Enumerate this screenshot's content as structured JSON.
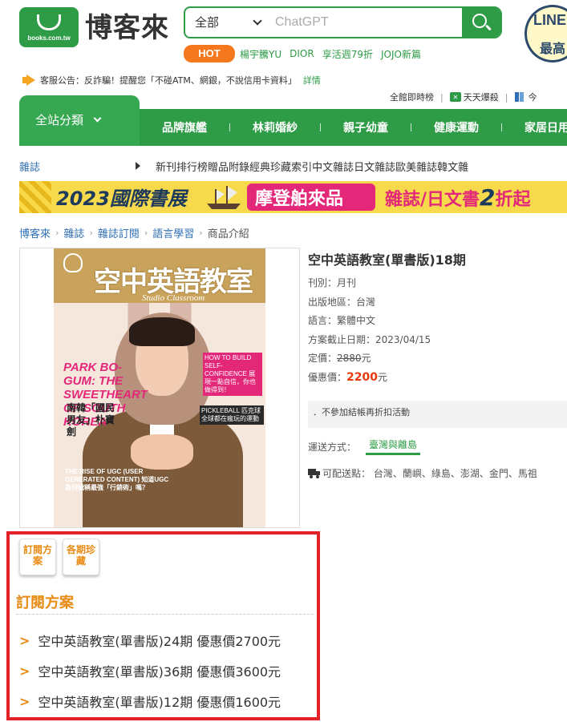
{
  "logo": {
    "text": "博客來",
    "sub": "books.com.tw"
  },
  "search": {
    "category": "全部",
    "placeholder": "ChatGPT"
  },
  "line_badge": {
    "top": "LINE",
    "bottom": "最高"
  },
  "hot": {
    "label": "HOT",
    "links": [
      "楊宇騰YU",
      "DIOR",
      "享活週79折",
      "JOJO新篇"
    ]
  },
  "notice": {
    "text": "客服公告：反詐騙！提醒您「不碰ATM、網銀，不說信用卡資料」",
    "more": "詳情"
  },
  "quick": {
    "item1": "全館即時榜",
    "item2": "天天爆殺",
    "item3": "今"
  },
  "catnav": {
    "all": "全站分類",
    "items": [
      "品牌旗艦",
      "林莉婚紗",
      "親子幼童",
      "健康運動",
      "家居日用"
    ]
  },
  "subnav": {
    "title": "雜誌",
    "links": [
      "新刊",
      "排行榜",
      "贈品附錄",
      "經典珍藏",
      "索引",
      "中文雜誌",
      "日文雜誌",
      "歐美雜誌",
      "韓文雜"
    ]
  },
  "banner": {
    "text1": "2023國際書展",
    "text2": "摩登舶來品",
    "text3a": "雜誌/日文書",
    "text3b": "2",
    "text3c": "折起"
  },
  "breadcrumb": [
    "博客來",
    "雜誌",
    "雜誌訂閱",
    "語言學習",
    "商品介紹"
  ],
  "cover": {
    "title": "空中英語教室",
    "sub": "Studio Classroom",
    "left1": "PARK BO-GUM: THE SWEETHEART OF SOUTH KOREA",
    "left2": "南韓「國民男友」朴寶劍",
    "right1": "HOW TO BUILD SELF-CONFIDENCE 展現一點自信，你也做得到！",
    "right2": "PICKLEBALL 匹克球 全球都在瘋玩的運動",
    "bottom": "THE RISE OF UGC (USER GENERATED CONTENT) 知道UGC為何號稱最強「行銷術」嗎？"
  },
  "product": {
    "title": "空中英語教室(單書版)18期",
    "frequency": "刊別：月刊",
    "origin": "出版地區：台灣",
    "language": "語言：繁體中文",
    "deadline": "方案截止日期：2023/04/15",
    "list_price_label": "定價：",
    "list_price": "2880",
    "unit": "元",
    "sale_price_label": "優惠價：",
    "sale_price": "2200",
    "promo": "．不參加結帳再折扣活動",
    "shipping_label": "運送方式：",
    "shipping_tab": "臺灣與離島",
    "destinations": "可配送點：  台灣、蘭嶼、綠島、澎湖、金門、馬祖"
  },
  "subscription": {
    "tab1": "訂閱方案",
    "tab2": "各期珍藏",
    "heading": "訂閱方案",
    "items": [
      "空中英語教室(單書版)24期 優惠價2700元",
      "空中英語教室(單書版)36期 優惠價3600元",
      "空中英語教室(單書版)12期 優惠價1600元"
    ]
  },
  "colors": {
    "brand_green": "#2e9b46",
    "accent_orange": "#e88a12",
    "price_red": "#e8380d",
    "highlight_red": "#e42127"
  }
}
